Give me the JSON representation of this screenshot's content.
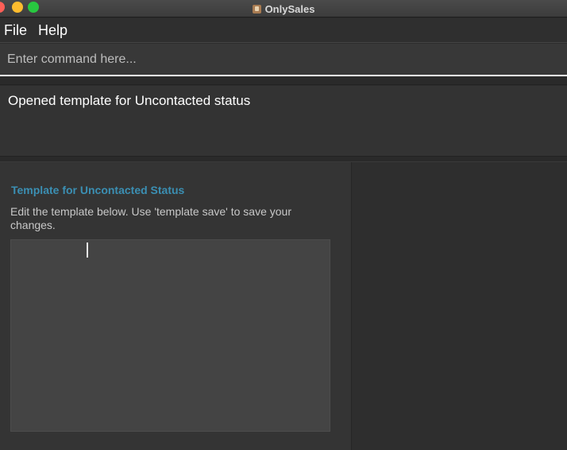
{
  "window": {
    "title": "OnlySales",
    "icon": "app-icon"
  },
  "menu": {
    "items": [
      "File",
      "Help"
    ]
  },
  "command": {
    "placeholder": "Enter command here...",
    "value": ""
  },
  "result": {
    "message": "Opened template for Uncontacted status"
  },
  "template_panel": {
    "heading": "Template for Uncontacted Status",
    "instructions": "Edit the template below. Use 'template save' to save your changes.",
    "content": ""
  },
  "colors": {
    "background": "#2c2c2c",
    "heading_accent": "#3b8fb3",
    "editor_bg": "#444444",
    "traffic_red": "#ff5f57",
    "traffic_yellow": "#febc2e",
    "traffic_green": "#28c840"
  }
}
